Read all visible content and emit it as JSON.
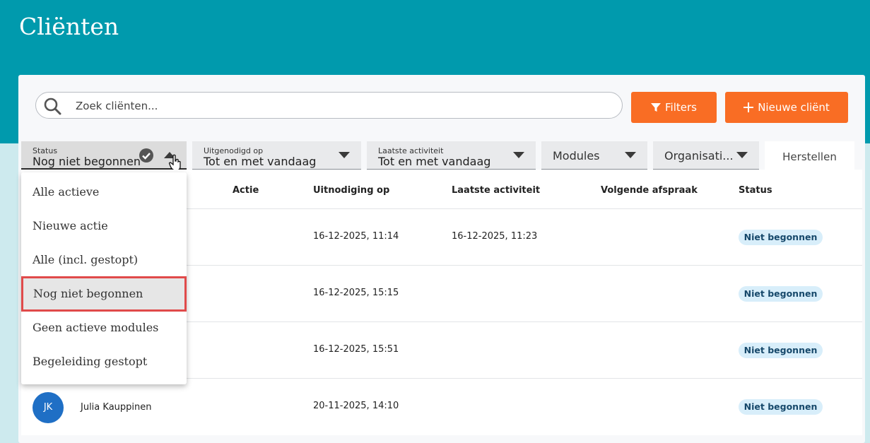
{
  "page": {
    "title": "Cliënten"
  },
  "search": {
    "placeholder": "Zoek cliënten..."
  },
  "buttons": {
    "filters": "Filters",
    "new_client": "Nieuwe cliënt",
    "reset": "Herstellen"
  },
  "filters": {
    "status": {
      "label": "Status",
      "value": "Nog niet begonnen"
    },
    "uitgenodigd": {
      "label": "Uitgenodigd op",
      "value": "Tot en met vandaag"
    },
    "activiteit": {
      "label": "Laatste activiteit",
      "value": "Tot en met vandaag"
    },
    "modules": {
      "value": "Modules"
    },
    "organisatie": {
      "value": "Organisati..."
    }
  },
  "status_dropdown": {
    "options": [
      "Alle actieve",
      "Nieuwe actie",
      "Alle (incl. gestopt)",
      "Nog niet begonnen",
      "Geen actieve modules",
      "Begeleiding gestopt"
    ],
    "selected_index": 3
  },
  "table": {
    "columns": [
      "Actie",
      "Uitnodiging op",
      "Laatste activiteit",
      "Volgende afspraak",
      "Status"
    ],
    "rows": [
      {
        "initials": "",
        "name": "",
        "uitnodiging": "16-12-2025, 11:14",
        "laatste_activiteit": "16-12-2025, 11:23",
        "volgende_afspraak": "",
        "status": "Niet begonnen"
      },
      {
        "initials": "",
        "name": "",
        "uitnodiging": "16-12-2025, 15:15",
        "laatste_activiteit": "",
        "volgende_afspraak": "",
        "status": "Niet begonnen"
      },
      {
        "initials": "",
        "name": "",
        "uitnodiging": "16-12-2025, 15:51",
        "laatste_activiteit": "",
        "volgende_afspraak": "",
        "status": "Niet begonnen"
      },
      {
        "initials": "JK",
        "name": "Julia Kauppinen",
        "uitnodiging": "20-11-2025, 14:10",
        "laatste_activiteit": "",
        "volgende_afspraak": "",
        "status": "Niet begonnen"
      }
    ]
  },
  "colors": {
    "header": "#009aad",
    "accent": "#f96d24",
    "avatar": "#1f6fc5",
    "badge_bg": "#d8eefa",
    "highlight": "#e04a4a"
  },
  "icons": {
    "search": "search-icon",
    "filter": "filter-icon",
    "plus": "plus-icon",
    "check": "check-circle-icon",
    "caret": "caret-icon",
    "hand": "hand-pointer-icon"
  }
}
